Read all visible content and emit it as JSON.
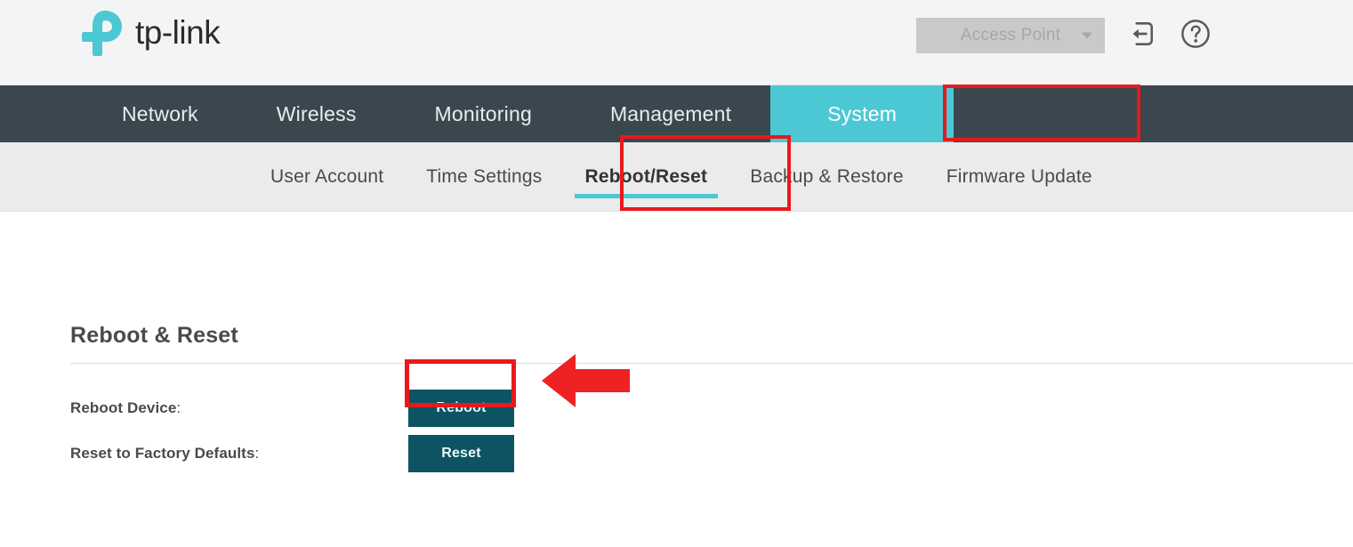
{
  "brand": {
    "name": "tp-link",
    "logo_color": "#4cc8d4",
    "text_color": "#2b2b2b"
  },
  "header": {
    "mode_select": {
      "value": "Access Point",
      "disabled": true,
      "caret_icon": "chevron-down-icon"
    },
    "logout_icon": "logout-icon",
    "help_icon": "help-circle-icon"
  },
  "main_nav": {
    "items": [
      {
        "label": "Network",
        "active": false
      },
      {
        "label": "Wireless",
        "active": false
      },
      {
        "label": "Monitoring",
        "active": false
      },
      {
        "label": "Management",
        "active": false
      },
      {
        "label": "System",
        "active": true
      }
    ],
    "active_color": "#4cc8d4",
    "background": "#3a474e"
  },
  "sub_nav": {
    "items": [
      {
        "label": "User Account",
        "active": false
      },
      {
        "label": "Time Settings",
        "active": false
      },
      {
        "label": "Reboot/Reset",
        "active": true
      },
      {
        "label": "Backup & Restore",
        "active": false
      },
      {
        "label": "Firmware Update",
        "active": false
      }
    ],
    "underline_color": "#4cc8d4",
    "background": "#ebebeb"
  },
  "content": {
    "page_title": "Reboot & Reset",
    "rows": [
      {
        "label": "Reboot Device",
        "colon": ":",
        "button_label": "Reboot",
        "highlighted": false
      },
      {
        "label": "Reset to Factory Defaults",
        "colon": ":",
        "button_label": "Reset",
        "highlighted": true
      }
    ],
    "button_color": "#0c5463"
  },
  "annotations": {
    "color": "#e8191c",
    "arrow_icon": "left-arrow-annotation",
    "boxes": [
      "System",
      "Reboot/Reset",
      "Reset"
    ]
  }
}
